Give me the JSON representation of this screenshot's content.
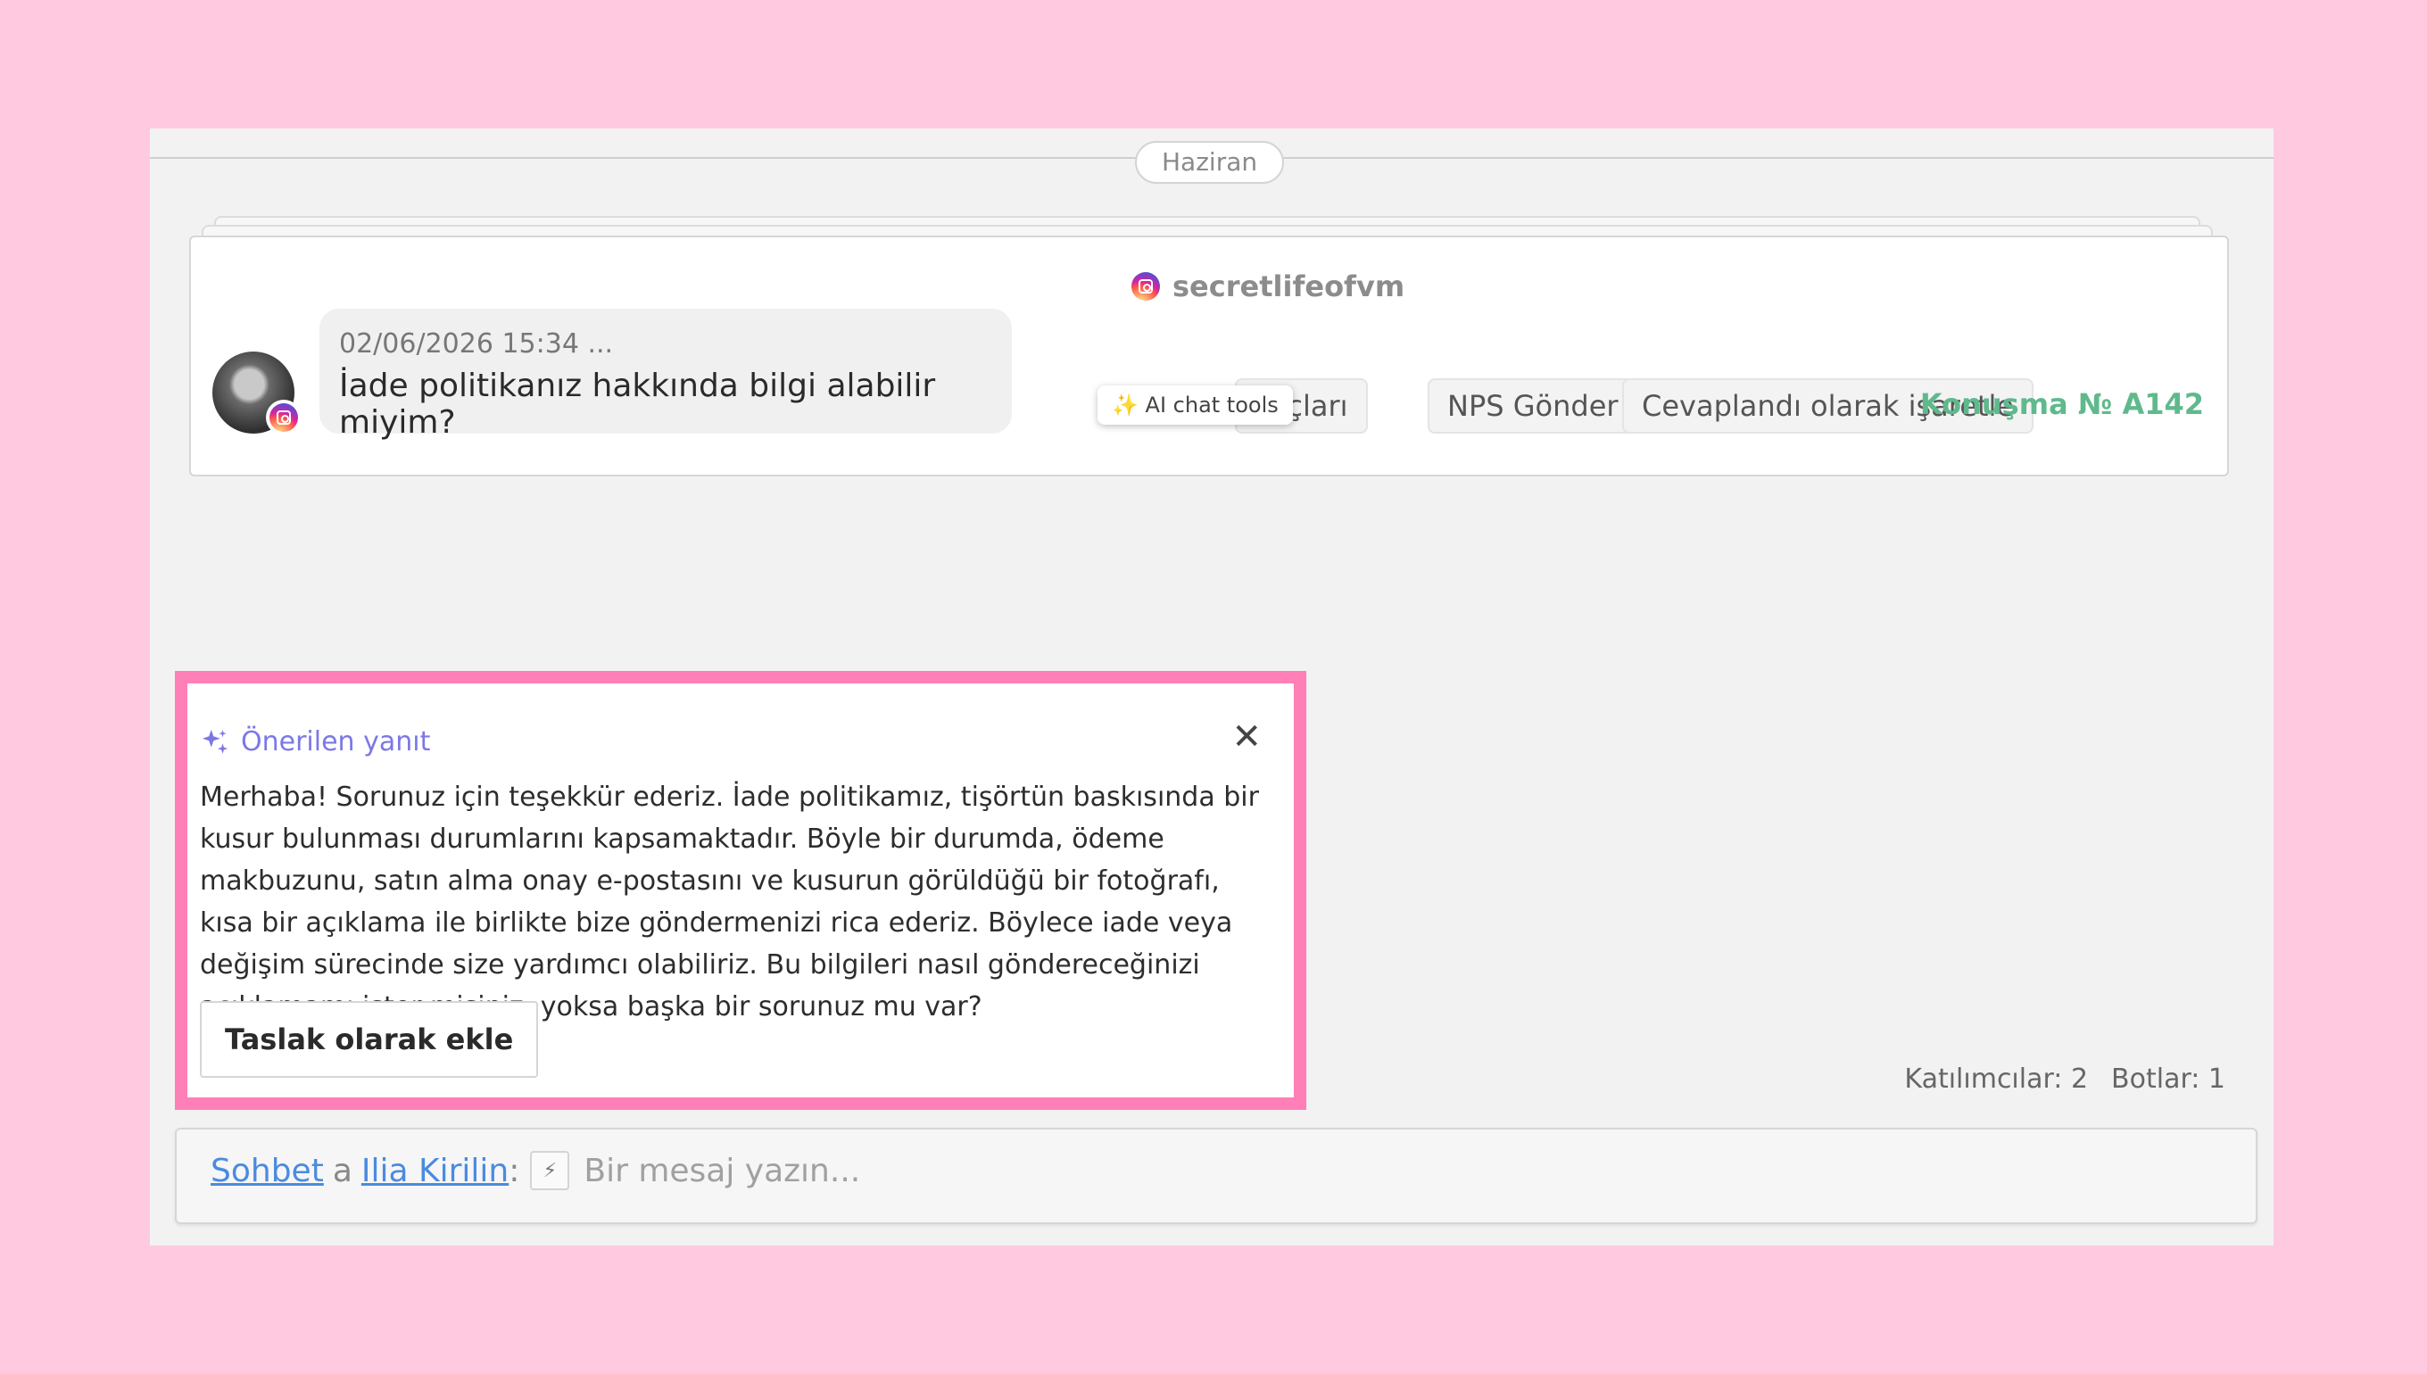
{
  "conversation": {
    "month_divider": "Haziran",
    "channel_name": "secretlifeofvm",
    "message": {
      "time": "02/06/2026 15:34 ...",
      "text": "İade politikanız hakkında bilgi alabilir miyim?"
    },
    "actions": {
      "ai_tools_tooltip": "AI chat tools",
      "ai_tools_label": "araçları",
      "nps_label": "NPS Gönder",
      "mark_answered_label": "Cevaplandı olarak işaretle",
      "conversation_id": "Konuşma № A142"
    }
  },
  "suggestion": {
    "title": "Önerilen yanıt",
    "body": "Merhaba! Sorunuz için teşekkür ederiz. İade politikamız, tişörtün baskısında bir kusur bulunması durumlarını kapsamaktadır. Böyle bir durumda, ödeme makbuzunu, satın alma onay e-postasını ve kusurun görüldüğü bir fotoğrafı, kısa bir açıklama ile birlikte bize göndermenizi rica ederiz. Böylece iade veya değişim sürecinde size yardımcı olabiliriz. Bu bilgileri nasıl göndereceğinizi açıklamamı ister misiniz, yoksa başka bir sorunuz mu var?",
    "add_draft_label": "Taslak olarak ekle",
    "close_symbol": "✕",
    "accent_color": "#ff7fb7"
  },
  "stats": {
    "participants": "Katılımcılar: 2",
    "bots": "Botlar: 1"
  },
  "composer": {
    "chat_link": "Sohbet",
    "connector": "a",
    "user_link": "Ilia Kirilin",
    "separator": ":",
    "placeholder": "Bir mesaj yazın..."
  }
}
